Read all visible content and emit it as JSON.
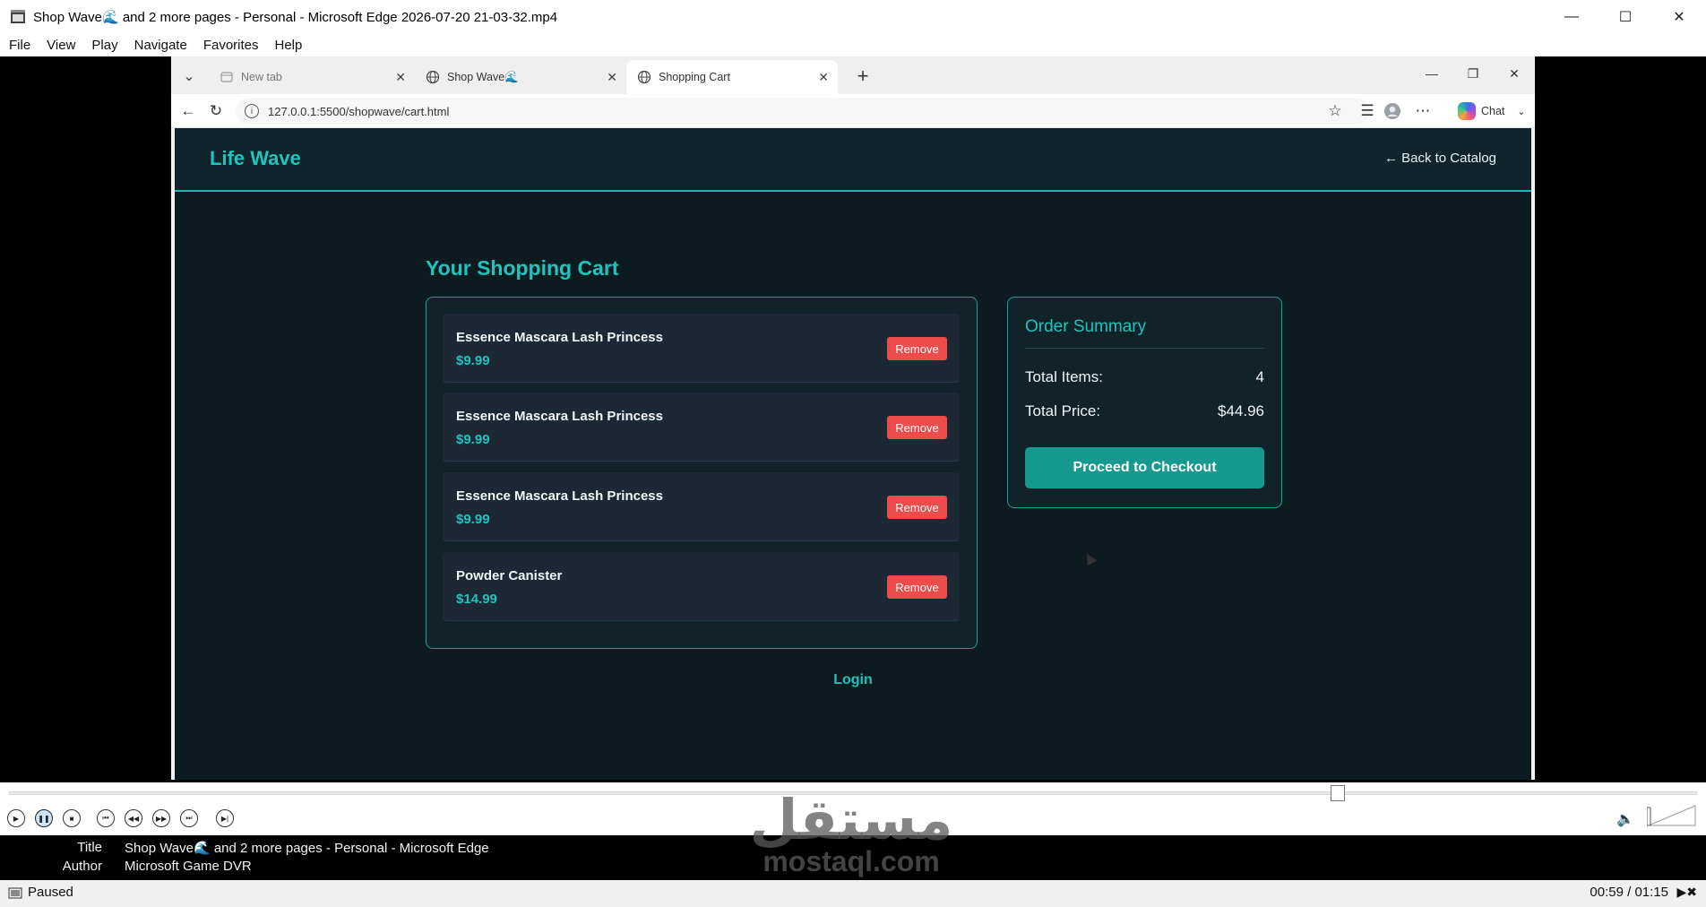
{
  "player": {
    "window_title": "Shop Wave🌊 and 2 more pages - Personal - Microsoft Edge 2026-07-20 21-03-32.mp4",
    "menu": [
      "File",
      "View",
      "Play",
      "Navigate",
      "Favorites",
      "Help"
    ],
    "status": "Paused",
    "time": "00:59 / 01:15",
    "progress_fraction": 0.787,
    "info": {
      "title_label": "Title",
      "title_value": "Shop Wave🌊 and 2 more pages - Personal - Microsoft Edge",
      "author_label": "Author",
      "author_value": "Microsoft Game DVR"
    },
    "watermark": {
      "arabic": "مستقل",
      "latin": "mostaql.com"
    }
  },
  "browser": {
    "tabs": [
      {
        "label": "New tab",
        "active": false
      },
      {
        "label": "Shop Wave🌊",
        "active": false
      },
      {
        "label": "Shopping Cart",
        "active": true
      }
    ],
    "url": "127.0.0.1:5500/shopwave/cart.html",
    "chat_label": "Chat"
  },
  "page": {
    "logo": "Life Wave",
    "back_link": "← Back to Catalog",
    "heading": "Your Shopping Cart",
    "items": [
      {
        "name": "Essence Mascara Lash Princess",
        "price": "$9.99",
        "remove": "Remove"
      },
      {
        "name": "Essence Mascara Lash Princess",
        "price": "$9.99",
        "remove": "Remove"
      },
      {
        "name": "Essence Mascara Lash Princess",
        "price": "$9.99",
        "remove": "Remove"
      },
      {
        "name": "Powder Canister",
        "price": "$14.99",
        "remove": "Remove"
      }
    ],
    "summary": {
      "title": "Order Summary",
      "items_label": "Total Items:",
      "items_value": "4",
      "price_label": "Total Price:",
      "price_value": "$44.96",
      "checkout_label": "Proceed to Checkout"
    },
    "login": "Login"
  },
  "colors": {
    "accent": "#20c3bd",
    "page_bg": "#0c1b20",
    "remove": "#ee4b4b",
    "checkout": "#16998f"
  }
}
